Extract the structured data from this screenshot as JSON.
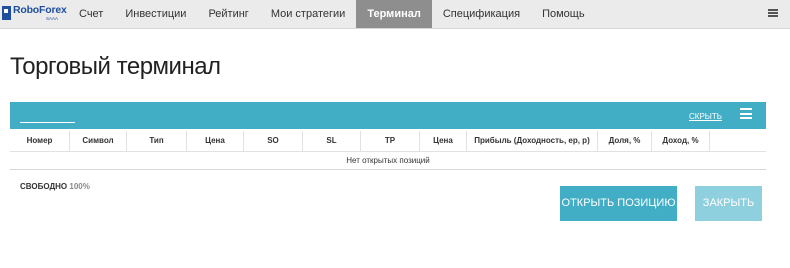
{
  "logo": {
    "text": "RoboForex",
    "sub": "SAAA"
  },
  "nav": {
    "items": [
      {
        "label": "Счет"
      },
      {
        "label": "Инвестиции"
      },
      {
        "label": "Рейтинг"
      },
      {
        "label": "Мои стратегии"
      },
      {
        "label": "Терминал",
        "active": true
      },
      {
        "label": "Спецификация"
      },
      {
        "label": "Помощь"
      }
    ]
  },
  "page": {
    "title": "Торговый терминал"
  },
  "terminal": {
    "hide_label": "СКРЫТЬ",
    "columns": [
      "Номер",
      "Символ",
      "Тип",
      "Цена",
      "SO",
      "SL",
      "TP",
      "Цена",
      "Прибыль (Доходность, ер, р)",
      "Доля, %",
      "Доход, %",
      ""
    ],
    "empty_text": "Нет открытых позиций",
    "free_label": "СВОБОДНО",
    "free_value": "100%"
  },
  "buttons": {
    "open": "ОТКРЫТЬ ПОЗИЦИЮ",
    "close": "ЗАКРЫТЬ"
  },
  "colors": {
    "accent": "#41aec6",
    "accent_light": "#8fd0df",
    "nav_active": "#8e8e8e",
    "brand": "#1e4f9c"
  }
}
